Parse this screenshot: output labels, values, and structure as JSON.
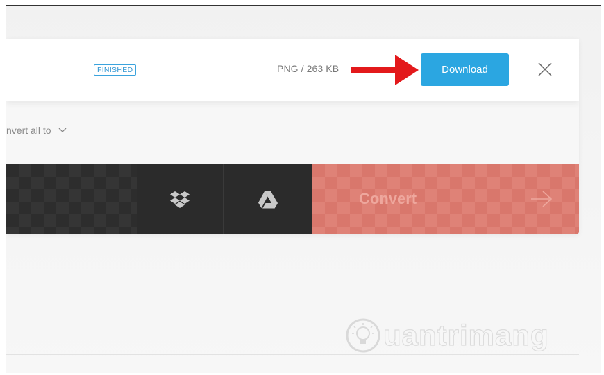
{
  "file_row": {
    "status": "FINISHED",
    "info": "PNG / 263 KB",
    "download_label": "Download",
    "close_icon": "close-icon"
  },
  "options": {
    "convert_all_label": "nvert all to",
    "chevron_icon": "chevron-down-icon"
  },
  "toolbar": {
    "dropbox_icon": "dropbox-icon",
    "drive_icon": "google-drive-icon",
    "convert_label": "Convert",
    "arrow_icon": "arrow-right-icon"
  },
  "watermark": {
    "text": "uantrimang"
  },
  "colors": {
    "accent": "#2ba6e1",
    "convert": "#d9776c",
    "annotation_arrow": "#e3191b",
    "dark_toolbar": "#2b2b2b"
  }
}
